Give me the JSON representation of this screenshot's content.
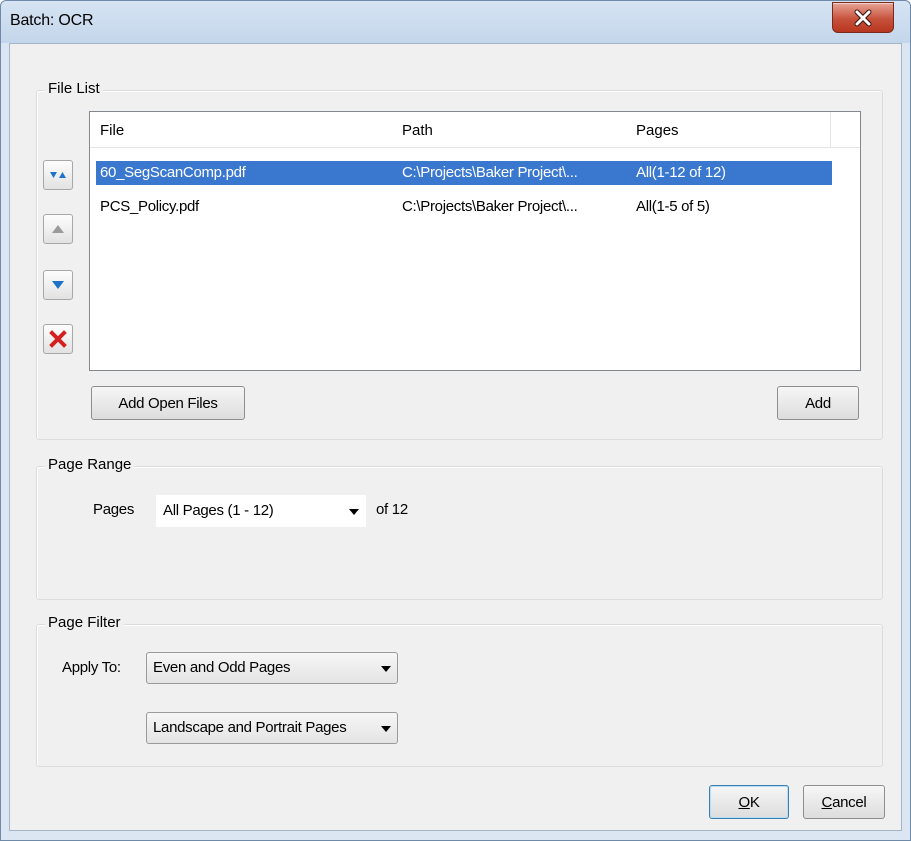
{
  "window": {
    "title": "Batch: OCR"
  },
  "file_list": {
    "group_label": "File List",
    "columns": [
      "File",
      "Path",
      "Pages"
    ],
    "rows": [
      {
        "file": "60_SegScanComp.pdf",
        "path": "C:\\Projects\\Baker Project\\...",
        "pages": "All(1-12 of 12)",
        "selected": true
      },
      {
        "file": "PCS_Policy.pdf",
        "path": "C:\\Projects\\Baker Project\\...",
        "pages": "All(1-5 of 5)",
        "selected": false
      }
    ],
    "side_buttons": [
      "sort-icon",
      "move-up-icon",
      "move-down-icon",
      "remove-icon"
    ],
    "add_open_files_label": "Add Open Files",
    "add_label": "Add"
  },
  "page_range": {
    "group_label": "Page Range",
    "pages_label": "Pages",
    "pages_value": "All Pages (1 - 12)",
    "of_text": "of 12"
  },
  "page_filter": {
    "group_label": "Page Filter",
    "apply_to_label": "Apply To:",
    "apply_to_value": "Even and Odd Pages",
    "orientation_value": "Landscape and Portrait Pages"
  },
  "footer": {
    "ok_accel": "O",
    "ok_rest": "K",
    "cancel_accel": "C",
    "cancel_rest": "ancel"
  },
  "colors": {
    "selection": "#3a78d0",
    "close_button": "#c7523c",
    "remove_icon": "#d32020",
    "arrow_icon": "#1e73c8"
  }
}
